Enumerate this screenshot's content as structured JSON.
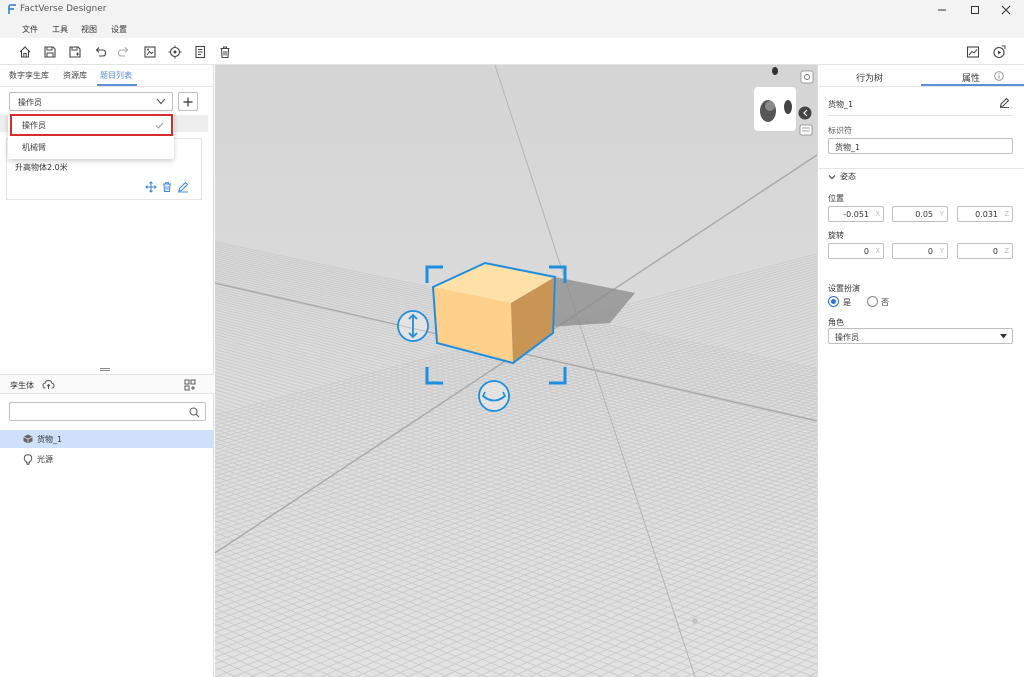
{
  "app": {
    "title": "FactVerse Designer"
  },
  "menu": [
    "文件",
    "工具",
    "视图",
    "设置"
  ],
  "left_tabs": [
    "数字孪生库",
    "资源库",
    "题目列表"
  ],
  "left_active_tab": "题目列表",
  "role_select": {
    "value": "操作员"
  },
  "dropdown": {
    "options": [
      "操作员",
      "机械臂"
    ],
    "selected": "操作员"
  },
  "task_card": {
    "name": "升高物体2.0米"
  },
  "twin_panel": {
    "title": "孪生体",
    "search_placeholder": "",
    "items": [
      {
        "label": "货物_1",
        "icon": "cube-icon",
        "selected": true
      },
      {
        "label": "光源",
        "icon": "lightbulb-icon",
        "selected": false
      }
    ]
  },
  "right_tabs": [
    "行为树",
    "属性"
  ],
  "right_active_tab": "属性",
  "props": {
    "object_name": "货物_1",
    "identifier_label": "标识符",
    "identifier_value": "货物_1",
    "pose_section": "姿态",
    "position_label": "位置",
    "position": {
      "x": "-0.051",
      "y": "0.05",
      "z": "0.031"
    },
    "rotation_label": "旋转",
    "rotation": {
      "x": "0",
      "y": "0",
      "z": "0"
    },
    "axis_labels": {
      "x": "X",
      "y": "Y",
      "z": "Z"
    },
    "set_actor_label": "设置扮演",
    "actor_yes": "是",
    "actor_no": "否",
    "actor_selected": "是",
    "role_label": "角色",
    "role_value": "操作员"
  },
  "colors": {
    "accent": "#5b8fd9",
    "selection_red": "#d62c2c",
    "cube_face": "#fdd08c",
    "gizmo_blue": "#1e8ee0",
    "tree_selected": "#cfe0fa"
  }
}
